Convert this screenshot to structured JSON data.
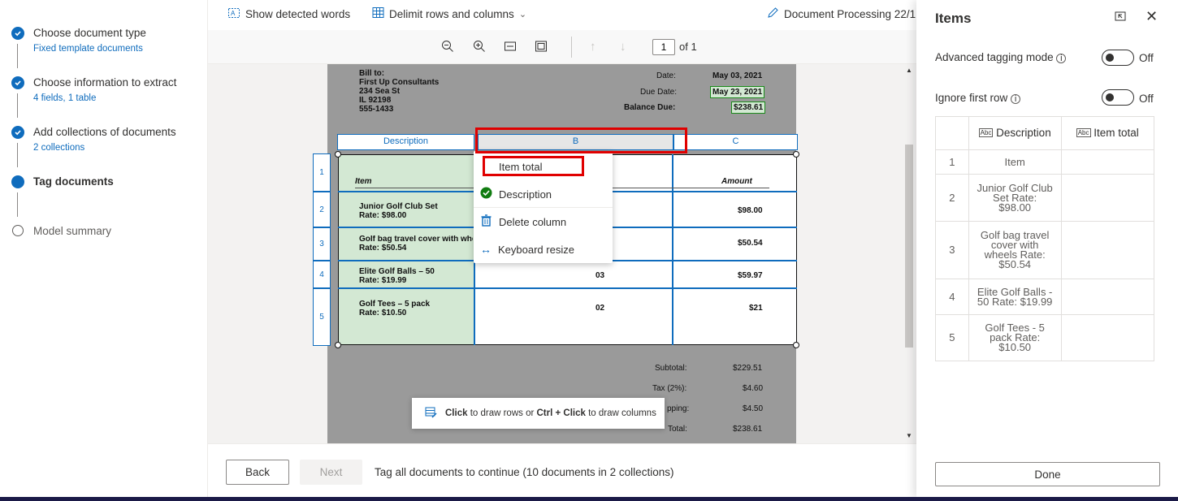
{
  "steps": [
    {
      "title": "Choose document type",
      "sub": "Fixed template documents",
      "state": "done"
    },
    {
      "title": "Choose information to extract",
      "sub": "4 fields, 1 table",
      "state": "done"
    },
    {
      "title": "Add collections of documents",
      "sub": "2 collections",
      "state": "done"
    },
    {
      "title": "Tag documents",
      "sub": "",
      "state": "current"
    },
    {
      "title": "Model summary",
      "sub": "",
      "state": "todo"
    }
  ],
  "toolbar": {
    "show_words": "Show detected words",
    "delimit": "Delimit rows and columns",
    "doc_name": "Document Processing 22/1("
  },
  "viewer": {
    "page_input": "1",
    "page_of": "of 1"
  },
  "document": {
    "bill_to": [
      "Bill to:",
      "First Up Consultants",
      "234 Sea St",
      "IL 92198",
      "555-1433"
    ],
    "date_label": "Date:",
    "date_value": "May 03, 2021",
    "due_label": "Due Date:",
    "due_value": "May 23, 2021",
    "balance_label": "Balance Due:",
    "balance_value": "$238.61",
    "col_headers": [
      "Description",
      "B",
      "C"
    ],
    "row_numbers": [
      "1",
      "2",
      "3",
      "4",
      "5"
    ],
    "header_item": "Item",
    "header_amount": "Amount",
    "rows": [
      {
        "desc1": "Junior Golf Club Set",
        "desc2": "Rate: $98.00",
        "qty": "",
        "amount": "$98.00"
      },
      {
        "desc1": "Golf bag travel cover with whee",
        "desc2": "Rate: $50.54",
        "qty": "",
        "amount": "$50.54"
      },
      {
        "desc1": "Elite Golf Balls – 50",
        "desc2": "Rate: $19.99",
        "qty": "03",
        "amount": "$59.97"
      },
      {
        "desc1": "Golf Tees – 5 pack",
        "desc2": "Rate: $10.50",
        "qty": "02",
        "amount": "$21"
      }
    ],
    "subtotal_label": "Subtotal:",
    "subtotal_value": "$229.51",
    "tax_label": "Tax (2%):",
    "tax_value": "$4.60",
    "shipping_label": "pping:",
    "shipping_value": "$4.50",
    "total_label": "Total:",
    "total_value": "$238.61"
  },
  "context_menu": {
    "item_total": "Item total",
    "description": "Description",
    "delete_column": "Delete column",
    "keyboard_resize": "Keyboard resize"
  },
  "tip": {
    "click": "Click",
    "text1": " to draw rows or ",
    "ctrl_click": "Ctrl + Click",
    "text2": " to draw columns"
  },
  "footer": {
    "back": "Back",
    "next": "Next",
    "status": "Tag all documents to continue (10 documents in 2 collections)"
  },
  "panel": {
    "title": "Items",
    "advanced_label": "Advanced tagging mode",
    "advanced_state": "Off",
    "ignore_label": "Ignore first row",
    "ignore_state": "Off",
    "col_description": "Description",
    "col_item_total": "Item total",
    "rows": [
      {
        "n": "1",
        "desc": "Item",
        "total": ""
      },
      {
        "n": "2",
        "desc": "Junior Golf Club Set Rate: $98.00",
        "total": ""
      },
      {
        "n": "3",
        "desc": "Golf bag travel cover with wheels Rate: $50.54",
        "total": ""
      },
      {
        "n": "4",
        "desc": "Elite Golf Balls - 50 Rate: $19.99",
        "total": ""
      },
      {
        "n": "5",
        "desc": "Golf Tees - 5 pack Rate: $10.50",
        "total": ""
      }
    ],
    "done": "Done"
  },
  "colors": {
    "accent": "#0f6cbd",
    "highlight": "#e00000",
    "cell_green": "#d3e8d3"
  }
}
